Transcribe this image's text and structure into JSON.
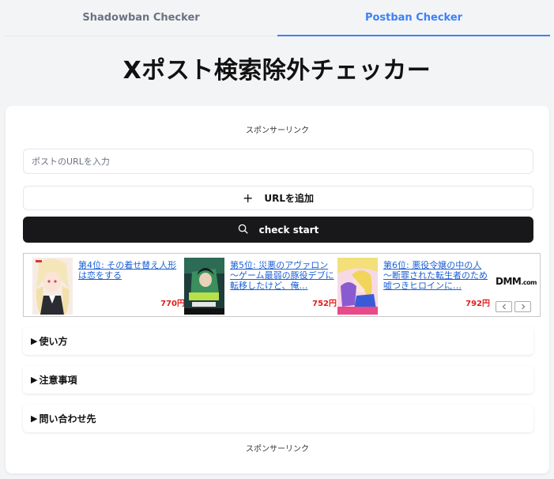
{
  "tabs": [
    {
      "label": "Shadowban Checker",
      "active": false
    },
    {
      "label": "Postban Checker",
      "active": true
    }
  ],
  "page_title": "Xポスト検索除外チェッカー",
  "sponsor_label": "スポンサーリンク",
  "url_input": {
    "placeholder": "ポストのURLを入力",
    "value": ""
  },
  "add_button": {
    "icon": "plus-icon",
    "label": "URLを追加"
  },
  "check_button": {
    "icon": "search-icon",
    "label": "check start"
  },
  "ad_banner": {
    "items": [
      {
        "title": "第4位: その着せ替え人形は恋をする",
        "price": "770円"
      },
      {
        "title": "第5位: 災悪のアヴァロン～ゲーム最弱の豚役デブに転移したけど、俺…",
        "price": "752円"
      },
      {
        "title": "第6位: 悪役令嬢の中の人～断罪された転生者のため嘘つきヒロインに…",
        "price": "792円"
      }
    ],
    "logo": "DMM",
    "logo_suffix": ".com"
  },
  "accordions": [
    {
      "label": "使い方",
      "icon": "triangle-right-icon"
    },
    {
      "label": "注意事項",
      "icon": "triangle-right-icon"
    },
    {
      "label": "問い合わせ先",
      "icon": "triangle-right-icon"
    }
  ],
  "colors": {
    "accent": "#3b82f6",
    "button_dark": "#18181b",
    "price_red": "#e01b1b",
    "link_blue": "#1a5fd6"
  }
}
